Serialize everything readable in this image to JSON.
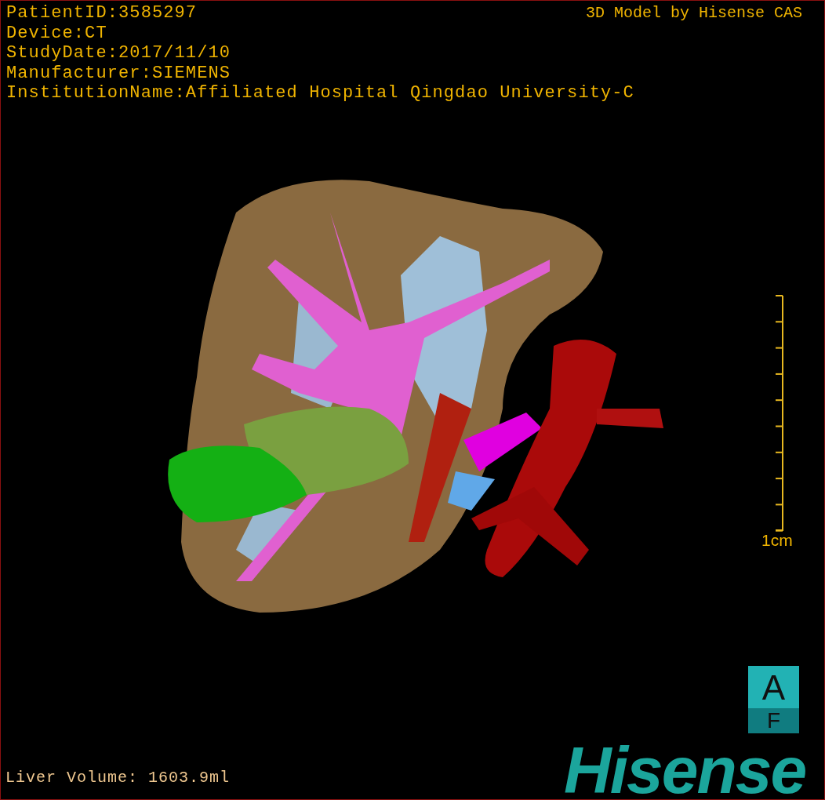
{
  "info_lines": [
    "PatientID:3585297",
    "Device:CT",
    "StudyDate:2017/11/10",
    "Manufacturer:SIEMENS",
    "InstitutionName:Affiliated Hospital Qingdao University-C"
  ],
  "model_credit": "3D Model by Hisense CAS",
  "model_view": {
    "kind": "figure"
  },
  "scale_bar": {
    "label": "1cm"
  },
  "orientation_cube": {
    "top": "A",
    "bottom": "F"
  },
  "liver_volume": "Liver Volume: 1603.9ml",
  "logo": "Hisense"
}
